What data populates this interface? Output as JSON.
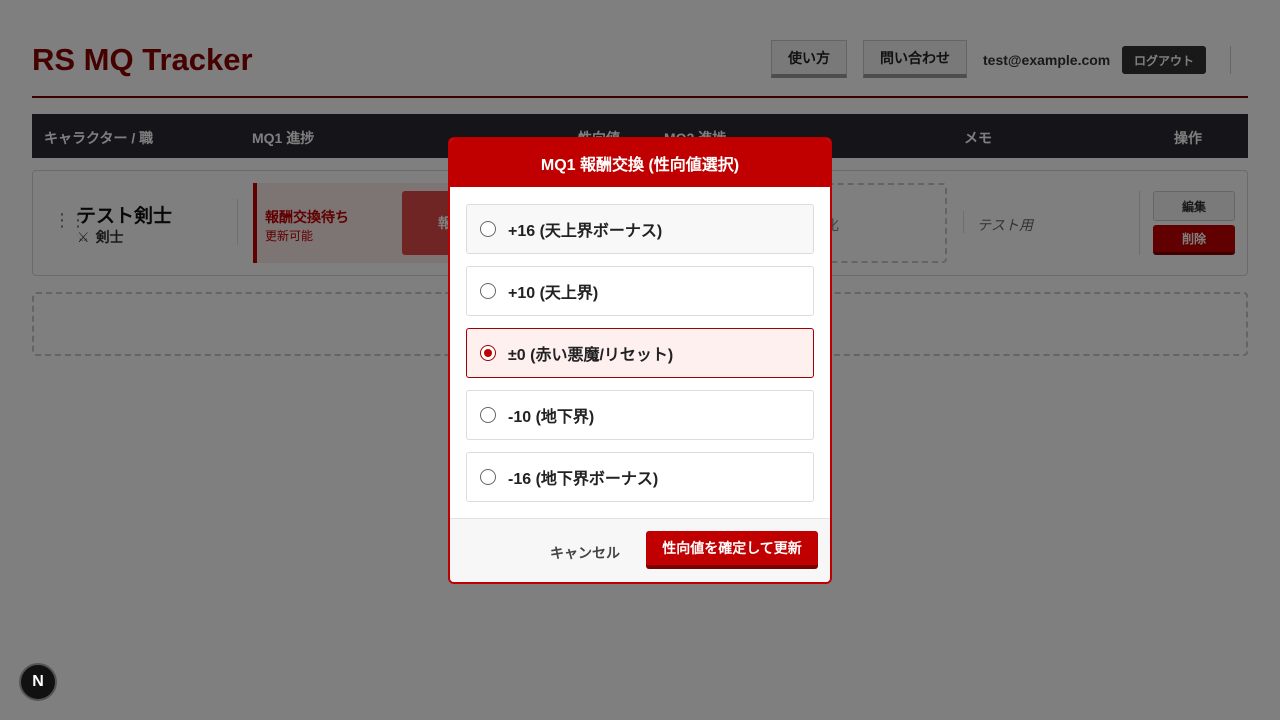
{
  "app": {
    "title": "RS MQ Tracker",
    "howto_label": "使い方",
    "contact_label": "問い合わせ",
    "user_email": "test@example.com",
    "logout_label": "ログアウト"
  },
  "table": {
    "headers": {
      "character": "キャラクター / 職",
      "mq1": "MQ1 進捗",
      "alignment": "性向値",
      "mq2": "MQ2 進捗",
      "memo": "メモ",
      "ops": "操作"
    },
    "rows": [
      {
        "name": "テスト剣士",
        "job_icon": "crossed-swords-icon",
        "job": "剣士",
        "mq1_status": "報酬交換待ち",
        "mq1_sub": "更新可能",
        "mq1_action": "報",
        "mq2_text": "化",
        "memo": "テスト用",
        "edit_label": "編集",
        "delete_label": "削除"
      }
    ]
  },
  "modal": {
    "title": "MQ1 報酬交換 (性向値選択)",
    "options": [
      {
        "label": "+16 (天上界ボーナス)",
        "selected": false
      },
      {
        "label": "+10 (天上界)",
        "selected": false
      },
      {
        "label": "±0 (赤い悪魔/リセット)",
        "selected": true
      },
      {
        "label": "-10 (地下界)",
        "selected": false
      },
      {
        "label": "-16 (地下界ボーナス)",
        "selected": false
      }
    ],
    "cancel_label": "キャンセル",
    "confirm_label": "性向値を確定して更新"
  },
  "dev_badge": {
    "label": "N"
  },
  "colors": {
    "accent": "#c00000",
    "title": "#8b0000",
    "table_header": "#2a2a33"
  }
}
